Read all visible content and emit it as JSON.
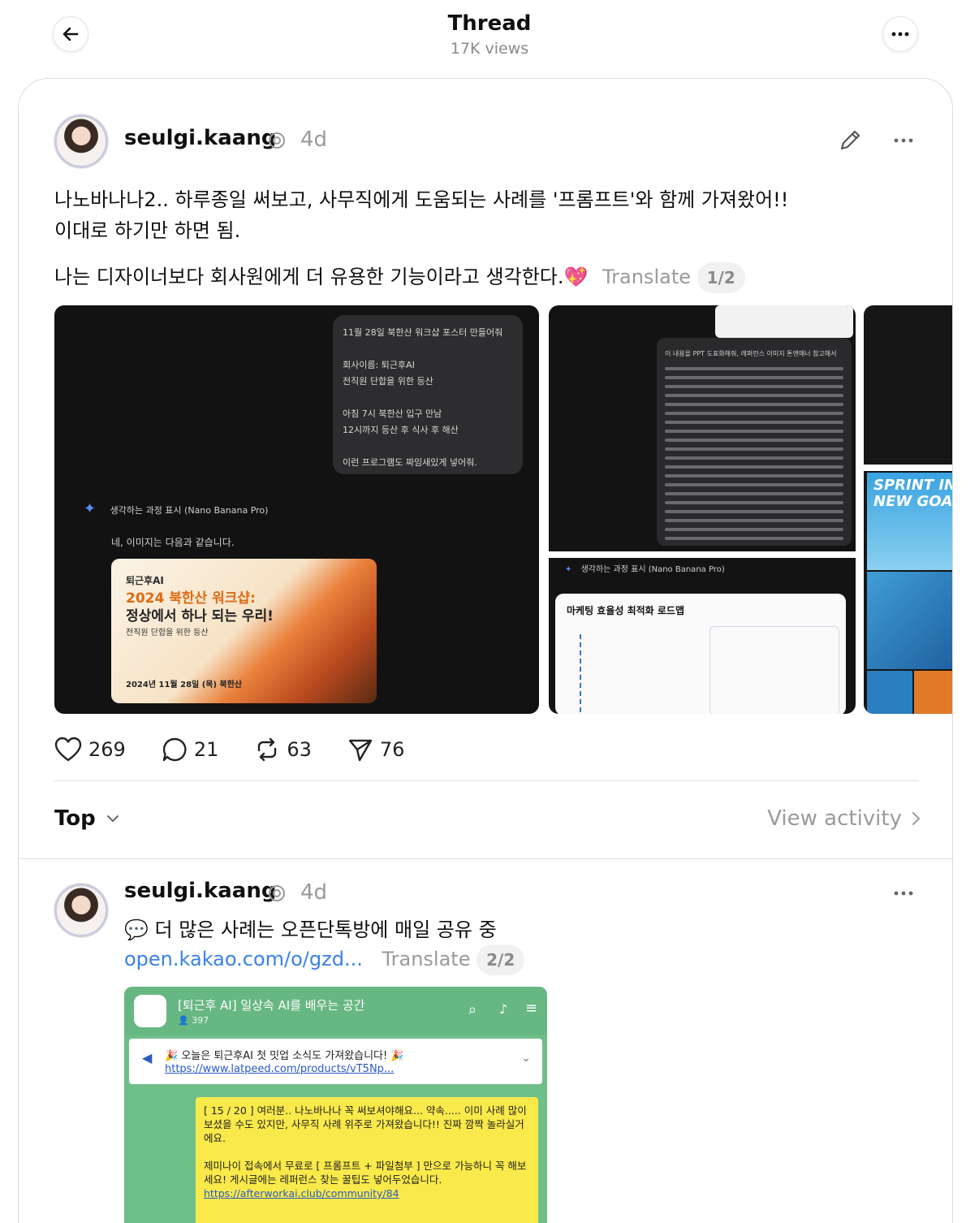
{
  "header": {
    "title": "Thread",
    "views": "17K views"
  },
  "post": {
    "username": "seulgi.kaang",
    "time": "4d",
    "line1": "나노바나나2.. 하루종일 써보고, 사무직에게 도움되는 사례를 '프롬프트'와 함께 가져왔어!!",
    "line2": "이대로 하기만 하면 됨.",
    "line3": "나는 디자이너보다 회사원에게 더 유용한 기능이라고 생각한다.💖",
    "translate": "Translate",
    "page": "1/2",
    "image1": {
      "bubble_title": "11월 28일 북한산 워크샵 포스터 만들어줘",
      "bubble_l1": "회사이름: 퇴근후AI",
      "bubble_l2": "전직원 단합을 위한 등산",
      "bubble_l3": "아침 7시 북한산 입구 만남",
      "bubble_l4": "12시까지 등산 후 식사 후 해산",
      "bubble_l5": "이런 프로그램도 짜임새있게 넣어줘.",
      "thinking": "생각하는 과정 표시 (Nano Banana Pro)",
      "answer": "네, 이미지는 다음과 같습니다.",
      "poster_brand": "퇴근후AI",
      "poster_title1": "2024 북한산 워크샵:",
      "poster_title2": "정상에서 하나 되는 우리!",
      "poster_sub": "전직원 단합을 위한 등산",
      "poster_date": "2024년 11월 28일 (목)  북한산"
    },
    "image2": {
      "panel_title": "이 내용을 PPT 도표화해줘, 레퍼런스 이미지 톤앤매너 참고해서",
      "thinking": "생각하는 과정 표시 (Nano Banana Pro)",
      "roadmap_title": "마케팅 효율성 최적화 로드맵"
    },
    "image3": {
      "banner": "SPRINT IN NEW GOA"
    },
    "likes": "269",
    "comments": "21",
    "reposts": "63",
    "shares": "76"
  },
  "sort": {
    "label": "Top",
    "activity": "View activity"
  },
  "reply": {
    "username": "seulgi.kaang",
    "time": "4d",
    "text": "💬 더 많은 사례는 오픈단톡방에 매일 공유 중",
    "link": "open.kakao.com/o/gzd...",
    "translate": "Translate",
    "page": "2/2",
    "kakao": {
      "title": "[퇴근후 AI] 일상속 AI를 배우는 공간",
      "count": "397",
      "notice": "🎉 오늘은 퇴근후AI 첫 밋업 소식도 가져왔습니다! 🎉",
      "notice_link": "https://www.latpeed.com/products/vT5Np...",
      "msg1": "[ 15 / 20 ] 여러분.. 나노바나나 꼭 써보셔야해요... 약속..... 이미 사례 많이 보셨을 수도 있지만, 사무직 사례 위주로 가져왔습니다!! 진짜 깜짝 놀라실거에요.",
      "msg2": "제미나이 접속에서 무료로 [ 프롬프트 + 파일첨부 ] 만으로 가능하니 꼭 해보세요! 게시글에는 레퍼런스 찾는 꿀팁도 넣어두었습니다.",
      "msg_link": "https://afterworkai.club/community/84"
    }
  }
}
